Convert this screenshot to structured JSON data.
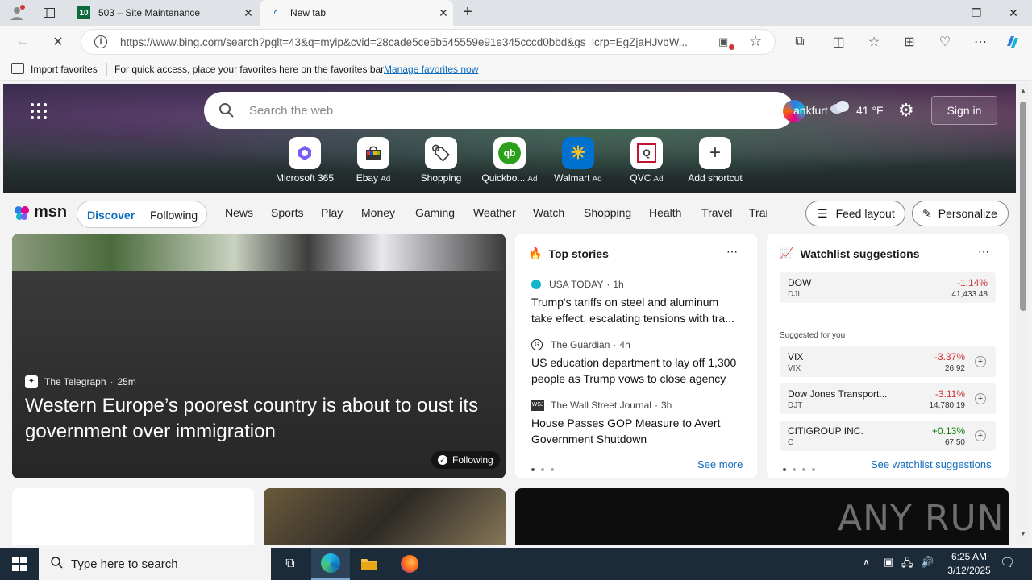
{
  "tabs": [
    {
      "title": "503 – Site Maintenance",
      "favicon_text": "10"
    },
    {
      "title": "New tab"
    }
  ],
  "address": {
    "url": "https://www.bing.com/search?pglt=43&q=myip&cvid=28cade5ce5b545559e91e345cccd0bbd&gs_lcrp=EgZjaHJvbW..."
  },
  "favbar": {
    "import_label": "Import favorites",
    "hint": "For quick access, place your favorites here on the favorites bar.",
    "manage_link": "Manage favorites now"
  },
  "hero": {
    "search_placeholder": "Search the web",
    "weather_city": "ankfurt",
    "weather_temp": "41 °F",
    "signin": "Sign in",
    "quicklinks": [
      {
        "label": "Microsoft 365",
        "ad": ""
      },
      {
        "label": "Ebay",
        "ad": "Ad"
      },
      {
        "label": "Shopping",
        "ad": ""
      },
      {
        "label": "Quickbo...",
        "ad": "Ad"
      },
      {
        "label": "Walmart",
        "ad": "Ad"
      },
      {
        "label": "QVC",
        "ad": "Ad"
      },
      {
        "label": "Add shortcut",
        "ad": ""
      }
    ]
  },
  "nav": {
    "logo": "msn",
    "tabs": [
      "Discover",
      "Following"
    ],
    "items": [
      "News",
      "Sports",
      "Play",
      "Money",
      "Gaming",
      "Weather",
      "Watch",
      "Shopping",
      "Health",
      "Travel",
      "Trai"
    ],
    "feed_layout": "Feed layout",
    "personalize": "Personalize"
  },
  "lead": {
    "source": "The Telegraph",
    "age": "25m",
    "title": "Western Europe’s poorest country is about to oust its government over immigration",
    "following": "Following"
  },
  "top_stories": {
    "header": "Top stories",
    "see_more": "See more",
    "items": [
      {
        "source": "USA TODAY",
        "age": "1h",
        "title": "Trump's tariffs on steel and aluminum take effect, escalating tensions with tra..."
      },
      {
        "source": "The Guardian",
        "age": "4h",
        "title": "US education department to lay off 1,300 people as Trump vows to close agency"
      },
      {
        "source": "The Wall Street Journal",
        "age": "3h",
        "title": "House Passes GOP Measure to Avert Government Shutdown"
      }
    ]
  },
  "watchlist": {
    "header": "Watchlist suggestions",
    "suggested_label": "Suggested for you",
    "see_link": "See watchlist suggestions",
    "main": {
      "name": "DOW",
      "symbol": "DJI",
      "change": "-1.14%",
      "price": "41,433.48"
    },
    "suggestions": [
      {
        "name": "VIX",
        "symbol": "VIX",
        "change": "-3.37%",
        "price": "26.92"
      },
      {
        "name": "Dow Jones Transport...",
        "symbol": "DJT",
        "change": "-3.11%",
        "price": "14,780.19"
      },
      {
        "name": "CITIGROUP INC.",
        "symbol": "C",
        "change": "+0.13%",
        "price": "67.50"
      }
    ]
  },
  "watermark": "ANY RUN",
  "taskbar": {
    "search_placeholder": "Type here to search",
    "time": "6:25 AM",
    "date": "3/12/2025"
  },
  "colors": {
    "accent": "#0f6cbd",
    "negative": "#d13438",
    "positive": "#107c10",
    "taskbar": "#1c2b3a"
  }
}
